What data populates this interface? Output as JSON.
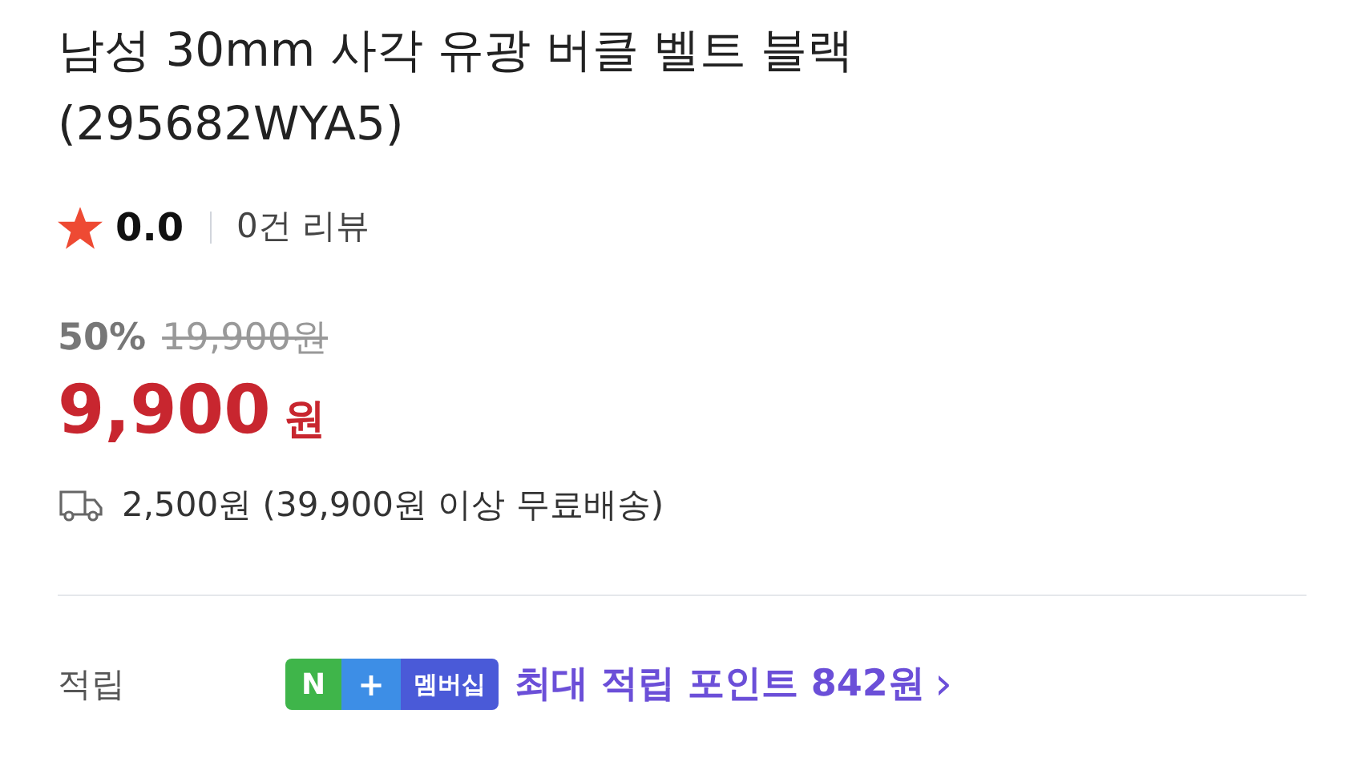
{
  "title": "남성 30mm 사각 유광 버클 벨트 블랙 (295682WYA5)",
  "rating": {
    "score": "0.0",
    "reviews": "0건 리뷰"
  },
  "price": {
    "discount": "50%",
    "original": "19,900원",
    "sale": "9,900",
    "currency": "원"
  },
  "shipping": "2,500원 (39,900원 이상 무료배송)",
  "points": {
    "label": "적립",
    "badge": [
      "N",
      "+",
      "멤버십"
    ],
    "text": "최대 적립 포인트 842원",
    "chevron": "›"
  }
}
